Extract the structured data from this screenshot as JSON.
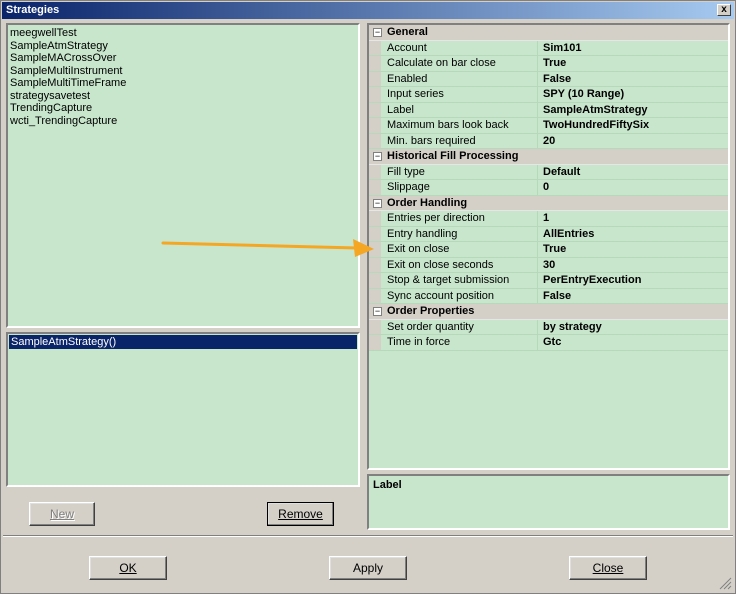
{
  "window": {
    "title": "Strategies",
    "close_glyph": "x"
  },
  "strategy_list": {
    "items": [
      "meegwellTest",
      "SampleAtmStrategy",
      "SampleMACrossOver",
      "SampleMultiInstrument",
      "SampleMultiTimeFrame",
      "strategysavetest",
      "TrendingCapture",
      "wcti_TrendingCapture"
    ]
  },
  "configured_list": {
    "items": [
      "SampleAtmStrategy()"
    ],
    "selected_index": 0
  },
  "buttons": {
    "new": "New",
    "remove": "Remove",
    "ok": "OK",
    "apply": "Apply",
    "close": "Close"
  },
  "properties": {
    "general": {
      "title": "General",
      "rows": [
        {
          "name": "Account",
          "value": "Sim101"
        },
        {
          "name": "Calculate on bar close",
          "value": "True"
        },
        {
          "name": "Enabled",
          "value": "False"
        },
        {
          "name": "Input series",
          "value": "SPY (10 Range)"
        },
        {
          "name": "Label",
          "value": "SampleAtmStrategy"
        },
        {
          "name": "Maximum bars look back",
          "value": "TwoHundredFiftySix"
        },
        {
          "name": "Min. bars required",
          "value": "20"
        }
      ]
    },
    "historical": {
      "title": "Historical Fill Processing",
      "rows": [
        {
          "name": "Fill type",
          "value": "Default"
        },
        {
          "name": "Slippage",
          "value": "0"
        }
      ]
    },
    "order_handling": {
      "title": "Order Handling",
      "rows": [
        {
          "name": "Entries per direction",
          "value": "1"
        },
        {
          "name": "Entry handling",
          "value": "AllEntries"
        },
        {
          "name": "Exit on close",
          "value": "True"
        },
        {
          "name": "Exit on close seconds",
          "value": "30"
        },
        {
          "name": "Stop & target submission",
          "value": "PerEntryExecution"
        },
        {
          "name": "Sync account position",
          "value": "False"
        }
      ]
    },
    "order_properties": {
      "title": "Order Properties",
      "rows": [
        {
          "name": "Set order quantity",
          "value": "by strategy"
        },
        {
          "name": "Time in force",
          "value": "Gtc"
        }
      ]
    }
  },
  "description": {
    "title": "Label"
  },
  "colors": {
    "panel_bg": "#c8e6cc",
    "selection": "#0a246a",
    "arrow": "#f5a623",
    "title_start": "#0a246a"
  },
  "icons": {
    "collapse": "minus-box-icon",
    "arrow": "orange-arrow-icon",
    "grip": "resize-grip-icon"
  }
}
